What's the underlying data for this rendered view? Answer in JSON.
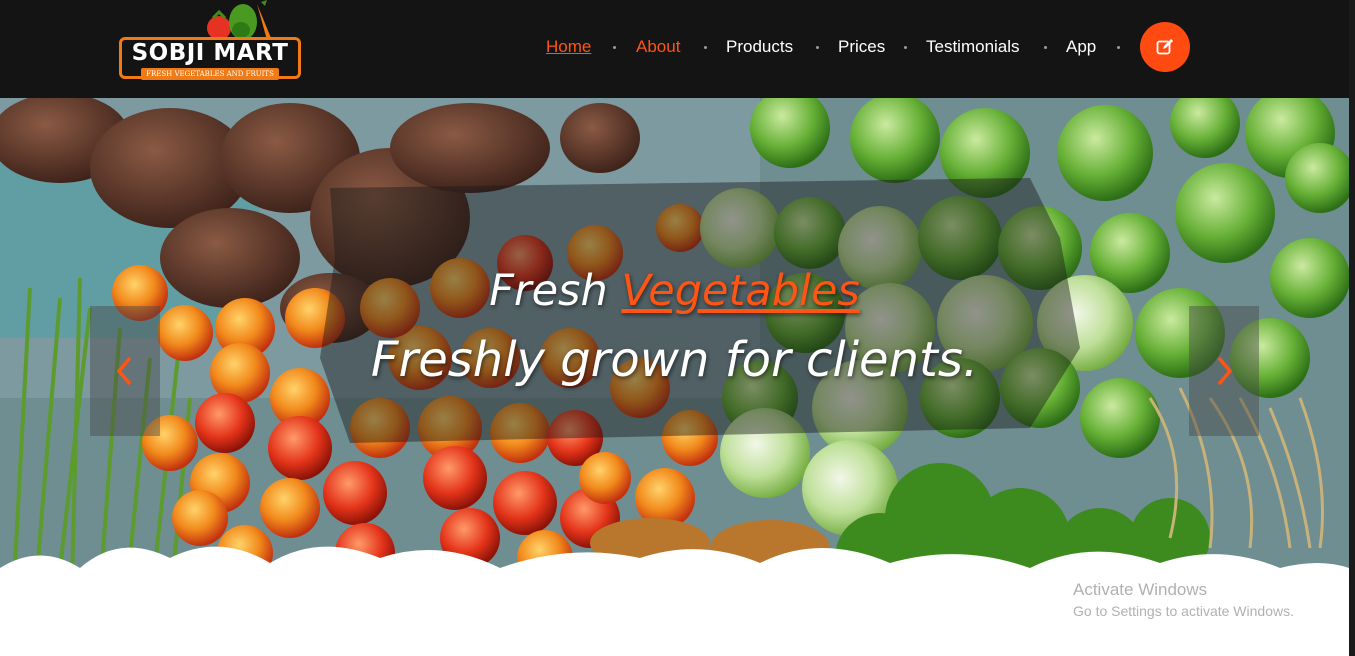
{
  "brand": {
    "name": "SOBJI MART",
    "tagline": "FRESH VEGETABLES AND FRUITS",
    "accent_color": "#ff5413",
    "logo_border_color": "#f07b16"
  },
  "nav": {
    "items": [
      {
        "label": "Home",
        "active": true
      },
      {
        "label": "About",
        "active": false
      },
      {
        "label": "Products",
        "active": false
      },
      {
        "label": "Prices",
        "active": false
      },
      {
        "label": "Testimonials",
        "active": false
      },
      {
        "label": "App",
        "active": false
      }
    ],
    "cta_icon": "edit-icon"
  },
  "hero": {
    "line1_prefix": "Fresh",
    "line1_accent": "Vegetables",
    "line2": "Freshly grown for clients.",
    "prev_icon": "chevron-left-icon",
    "next_icon": "chevron-right-icon"
  },
  "system_watermark": {
    "line1": "Activate Windows",
    "line2": "Go to Settings to activate Windows."
  }
}
